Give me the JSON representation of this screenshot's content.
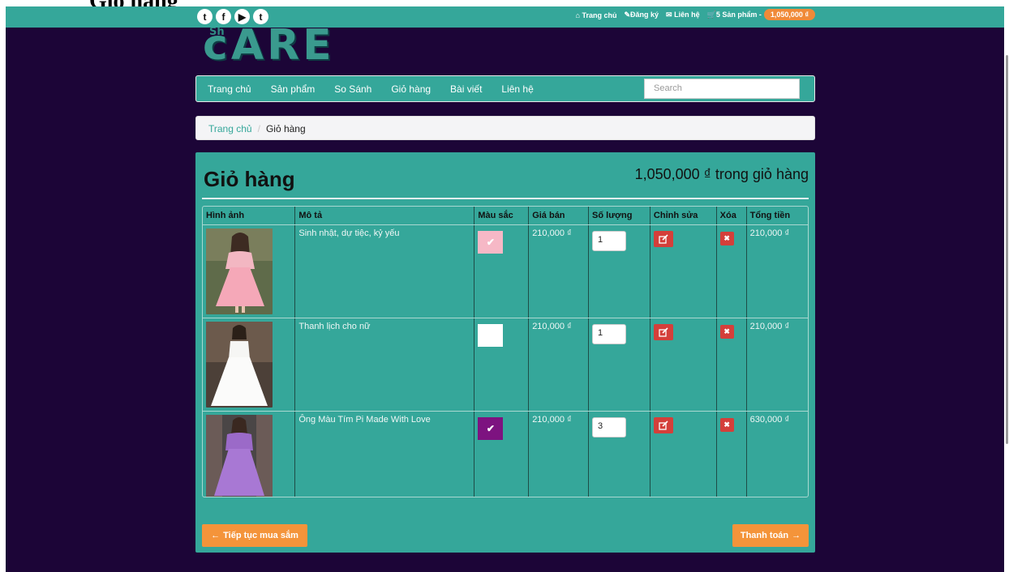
{
  "page_heading": "Giỏ hàng",
  "topbar": {
    "social": [
      {
        "icon": "twitter-icon",
        "glyph": "t"
      },
      {
        "icon": "facebook-icon",
        "glyph": "f"
      },
      {
        "icon": "youtube-icon",
        "glyph": "▶"
      },
      {
        "icon": "tumblr-icon",
        "glyph": "t"
      }
    ],
    "links": {
      "home": "Trang chủ",
      "register": "Đăng ký",
      "contact": "Liên hệ",
      "cart": "5 Sản phẩm -",
      "cart_total": "1,050,000 ₫"
    }
  },
  "logo": {
    "text": "cARE",
    "small_text": "Sh"
  },
  "nav": {
    "items": [
      "Trang chủ",
      "Sản phẩm",
      "So Sánh",
      "Giỏ hàng",
      "Bài viết",
      "Liên hệ"
    ],
    "search_placeholder": "Search"
  },
  "breadcrumb": {
    "home": "Trang chủ",
    "current": "Giỏ hàng"
  },
  "cart": {
    "title": "Giỏ hàng",
    "total": "1,050,000 ₫ trong giỏ hàng",
    "columns": [
      "Hình ảnh",
      "Mô tả",
      "Màu sắc",
      "Giá bán",
      "Số lượng",
      "Chỉnh sửa",
      "Xóa",
      "Tổng tiền"
    ],
    "items": [
      {
        "description": "Sinh nhật, dự tiệc, kỷ yếu",
        "color": "#f6b8c6",
        "checked": true,
        "price": "210,000 ₫",
        "qty": "1",
        "total": "210,000 ₫"
      },
      {
        "description": "Thanh lịch cho nữ",
        "color": "#ffffff",
        "checked": false,
        "price": "210,000 ₫",
        "qty": "1",
        "total": "210,000 ₫"
      },
      {
        "description": "Ông Màu Tím Pi Made With Love",
        "color": "#7d1380",
        "checked": true,
        "price": "210,000 ₫",
        "qty": "3",
        "total": "630,000 ₫"
      }
    ],
    "continue_label": "Tiếp tục mua sắm",
    "checkout_label": "Thanh toán"
  },
  "colors": {
    "teal": "#35a79a",
    "background": "#1c0537",
    "orange": "#f4943a",
    "red": "#d43f3a"
  }
}
